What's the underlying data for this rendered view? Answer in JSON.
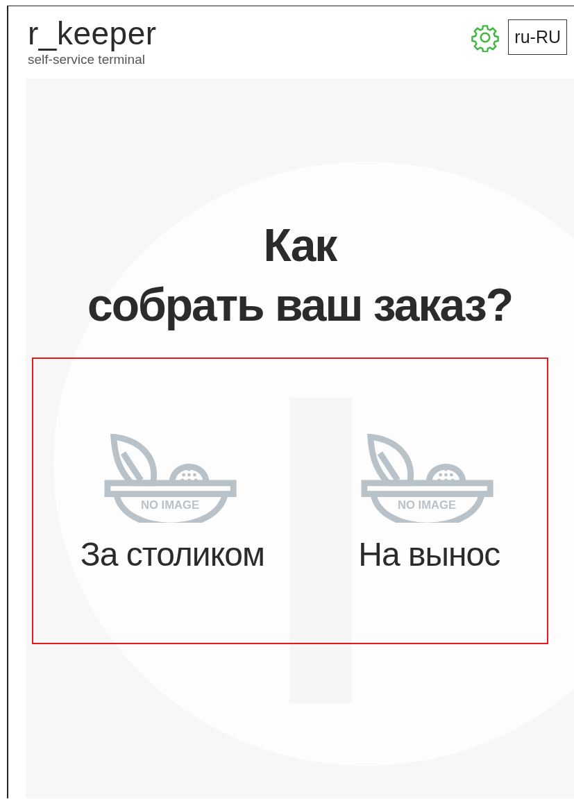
{
  "header": {
    "logo": "r_keeper",
    "subtitle": "self-service terminal",
    "language": "ru-RU"
  },
  "title": "Как\nсобрать ваш заказ?",
  "options": [
    {
      "label": "За столиком",
      "image_label": "NO IMAGE"
    },
    {
      "label": "На вынос",
      "image_label": "NO IMAGE"
    }
  ]
}
